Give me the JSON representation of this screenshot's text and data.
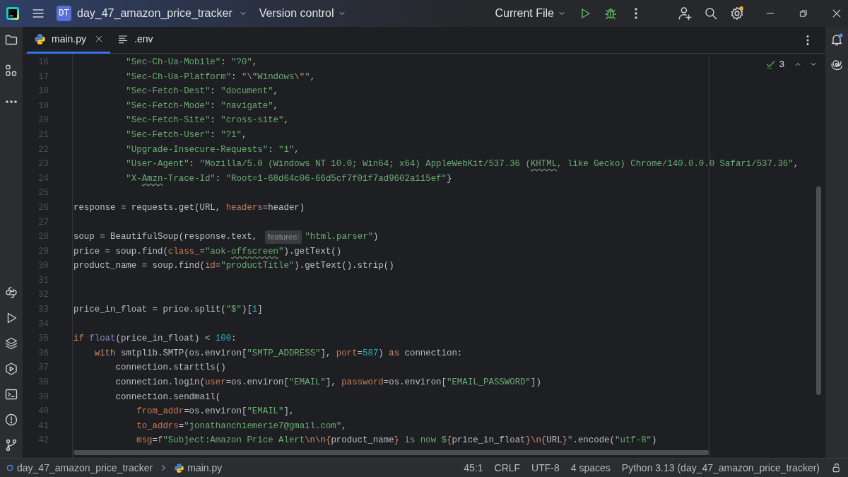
{
  "title_bar": {
    "project_badge": "DT",
    "project": "day_47_amazon_price_tracker",
    "vcs": "Version control",
    "run_config": "Current File"
  },
  "tabs": [
    {
      "label": "main.py",
      "kind": "python",
      "selected": true
    },
    {
      "label": ".env",
      "kind": "text",
      "selected": false
    }
  ],
  "inspection": {
    "count": "3"
  },
  "code_lines": [
    {
      "number": "16",
      "tokens": [
        {
          "text": "          \"Sec-Ch-Ua-Mobile\"",
          "kind": "s"
        },
        {
          "text": ": ",
          "kind": "p"
        },
        {
          "text": "\"?0\"",
          "kind": "s"
        },
        {
          "text": ",",
          "kind": "p"
        }
      ]
    },
    {
      "number": "17",
      "tokens": [
        {
          "text": "          \"Sec-Ch-Ua-Platform\"",
          "kind": "s"
        },
        {
          "text": ": ",
          "kind": "p"
        },
        {
          "text": "\"",
          "kind": "s"
        },
        {
          "text": "\\\"",
          "kind": "e"
        },
        {
          "text": "Windows",
          "kind": "s"
        },
        {
          "text": "\\\"",
          "kind": "e"
        },
        {
          "text": "\"",
          "kind": "s"
        },
        {
          "text": ",",
          "kind": "p"
        }
      ]
    },
    {
      "number": "18",
      "tokens": [
        {
          "text": "          \"Sec-Fetch-Dest\"",
          "kind": "s"
        },
        {
          "text": ": ",
          "kind": "p"
        },
        {
          "text": "\"document\"",
          "kind": "s"
        },
        {
          "text": ",",
          "kind": "p"
        }
      ]
    },
    {
      "number": "19",
      "tokens": [
        {
          "text": "          \"Sec-Fetch-Mode\"",
          "kind": "s"
        },
        {
          "text": ": ",
          "kind": "p"
        },
        {
          "text": "\"navigate\"",
          "kind": "s"
        },
        {
          "text": ",",
          "kind": "p"
        }
      ]
    },
    {
      "number": "20",
      "tokens": [
        {
          "text": "          \"Sec-Fetch-Site\"",
          "kind": "s"
        },
        {
          "text": ": ",
          "kind": "p"
        },
        {
          "text": "\"cross-site\"",
          "kind": "s"
        },
        {
          "text": ",",
          "kind": "p"
        }
      ]
    },
    {
      "number": "21",
      "tokens": [
        {
          "text": "          \"Sec-Fetch-User\"",
          "kind": "s"
        },
        {
          "text": ": ",
          "kind": "p"
        },
        {
          "text": "\"?1\"",
          "kind": "s"
        },
        {
          "text": ",",
          "kind": "p"
        }
      ]
    },
    {
      "number": "22",
      "tokens": [
        {
          "text": "          \"Upgrade-Insecure-Requests\"",
          "kind": "s"
        },
        {
          "text": ": ",
          "kind": "p"
        },
        {
          "text": "\"1\"",
          "kind": "s"
        },
        {
          "text": ",",
          "kind": "p"
        }
      ]
    },
    {
      "number": "23",
      "tokens": [
        {
          "text": "          \"User-Agent\"",
          "kind": "s"
        },
        {
          "text": ": ",
          "kind": "p"
        },
        {
          "text": "\"Mozilla/5.0 (Windows NT 10.0; Win64; x64) AppleWebKit/537.36 (",
          "kind": "s"
        },
        {
          "text": "KHTML",
          "kind": "typo"
        },
        {
          "text": ", like Gecko) Chrome/140.0.0.0 Safari/537.36\"",
          "kind": "s"
        },
        {
          "text": ",",
          "kind": "p"
        }
      ]
    },
    {
      "number": "24",
      "tokens": [
        {
          "text": "          \"X-",
          "kind": "s"
        },
        {
          "text": "Amzn",
          "kind": "typo"
        },
        {
          "text": "-Trace-Id\"",
          "kind": "s"
        },
        {
          "text": ": ",
          "kind": "p"
        },
        {
          "text": "\"Root=1-68d64c06-66d5cf7f01f7ad9602a115ef\"",
          "kind": "s"
        },
        {
          "text": "}",
          "kind": "p"
        }
      ]
    },
    {
      "number": "25"
    },
    {
      "number": "26",
      "tokens": [
        {
          "text": "response = requests.get(URL, ",
          "kind": "p"
        },
        {
          "text": "headers",
          "kind": "a"
        },
        {
          "text": "=header)",
          "kind": "p"
        }
      ]
    },
    {
      "number": "27"
    },
    {
      "number": "28",
      "tokens": [
        {
          "text": "soup = BeautifulSoup(response.text, ",
          "kind": "p"
        },
        {
          "text": "features:",
          "kind": "h"
        },
        {
          "text": "\"html.parser\"",
          "kind": "s"
        },
        {
          "text": ")",
          "kind": "p"
        }
      ]
    },
    {
      "number": "29",
      "tokens": [
        {
          "text": "price = soup.find(",
          "kind": "p"
        },
        {
          "text": "class_",
          "kind": "a"
        },
        {
          "text": "=",
          "kind": "p"
        },
        {
          "text": "\"aok-",
          "kind": "s"
        },
        {
          "text": "offscreen",
          "kind": "typo"
        },
        {
          "text": "\"",
          "kind": "s"
        },
        {
          "text": ").getText()",
          "kind": "p"
        }
      ]
    },
    {
      "number": "30",
      "tokens": [
        {
          "text": "product_name = soup.find(",
          "kind": "p"
        },
        {
          "text": "id",
          "kind": "a"
        },
        {
          "text": "=",
          "kind": "p"
        },
        {
          "text": "\"productTitle\"",
          "kind": "s"
        },
        {
          "text": ").getText().strip()",
          "kind": "p"
        }
      ]
    },
    {
      "number": "31"
    },
    {
      "number": "32"
    },
    {
      "number": "33",
      "tokens": [
        {
          "text": "price_in_float = price.split(",
          "kind": "p"
        },
        {
          "text": "\"$\"",
          "kind": "s"
        },
        {
          "text": ")[",
          "kind": "p"
        },
        {
          "text": "1",
          "kind": "n"
        },
        {
          "text": "]",
          "kind": "p"
        }
      ]
    },
    {
      "number": "34"
    },
    {
      "number": "35",
      "tokens": [
        {
          "text": "if ",
          "kind": "k"
        },
        {
          "text": "float",
          "kind": "b"
        },
        {
          "text": "(price_in_float) < ",
          "kind": "p"
        },
        {
          "text": "100",
          "kind": "n"
        },
        {
          "text": ":",
          "kind": "p"
        }
      ]
    },
    {
      "number": "36",
      "tokens": [
        {
          "text": "    with ",
          "kind": "k"
        },
        {
          "text": "smtplib.SMTP(os.environ[",
          "kind": "p"
        },
        {
          "text": "\"SMTP_ADDRESS\"",
          "kind": "s"
        },
        {
          "text": "], ",
          "kind": "p"
        },
        {
          "text": "port",
          "kind": "a"
        },
        {
          "text": "=",
          "kind": "p"
        },
        {
          "text": "587",
          "kind": "n"
        },
        {
          "text": ") ",
          "kind": "p"
        },
        {
          "text": "as",
          "kind": "k"
        },
        {
          "text": " connection:",
          "kind": "p"
        }
      ]
    },
    {
      "number": "37",
      "tokens": [
        {
          "text": "        connection.starttls()",
          "kind": "p"
        }
      ]
    },
    {
      "number": "38",
      "tokens": [
        {
          "text": "        connection.login(",
          "kind": "p"
        },
        {
          "text": "user",
          "kind": "a"
        },
        {
          "text": "=os.environ[",
          "kind": "p"
        },
        {
          "text": "\"EMAIL\"",
          "kind": "s"
        },
        {
          "text": "], ",
          "kind": "p"
        },
        {
          "text": "password",
          "kind": "a"
        },
        {
          "text": "=os.environ[",
          "kind": "p"
        },
        {
          "text": "\"EMAIL_PASSWORD\"",
          "kind": "s"
        },
        {
          "text": "])",
          "kind": "p"
        }
      ]
    },
    {
      "number": "39",
      "tokens": [
        {
          "text": "        connection.sendmail(",
          "kind": "p"
        }
      ]
    },
    {
      "number": "40",
      "tokens": [
        {
          "text": "            from_addr",
          "kind": "a"
        },
        {
          "text": "=os.environ[",
          "kind": "p"
        },
        {
          "text": "\"EMAIL\"",
          "kind": "s"
        },
        {
          "text": "],",
          "kind": "p"
        }
      ]
    },
    {
      "number": "41",
      "tokens": [
        {
          "text": "            to_addrs",
          "kind": "a"
        },
        {
          "text": "=",
          "kind": "p"
        },
        {
          "text": "\"jonathanchiemerie7@gmail.com\"",
          "kind": "s"
        },
        {
          "text": ",",
          "kind": "p"
        }
      ]
    },
    {
      "number": "42",
      "tokens": [
        {
          "text": "            msg",
          "kind": "a"
        },
        {
          "text": "=",
          "kind": "p"
        },
        {
          "text": "f",
          "kind": "k"
        },
        {
          "text": "\"Subject:Amazon Price Alert",
          "kind": "s"
        },
        {
          "text": "\\n\\n{",
          "kind": "e"
        },
        {
          "text": "product_name",
          "kind": "p"
        },
        {
          "text": "}",
          "kind": "e"
        },
        {
          "text": " is now $",
          "kind": "s"
        },
        {
          "text": "{",
          "kind": "e"
        },
        {
          "text": "price_in_float",
          "kind": "p"
        },
        {
          "text": "}\\n{",
          "kind": "e"
        },
        {
          "text": "URL",
          "kind": "p"
        },
        {
          "text": "}",
          "kind": "e"
        },
        {
          "text": "\"",
          "kind": "s"
        },
        {
          "text": ".encode(",
          "kind": "p"
        },
        {
          "text": "\"utf-8\"",
          "kind": "s"
        },
        {
          "text": ")",
          "kind": "p"
        }
      ]
    }
  ],
  "breadcrumbs": [
    {
      "label": "day_47_amazon_price_tracker",
      "kind": "module"
    },
    {
      "label": "main.py",
      "kind": "python"
    }
  ],
  "status_bar": [
    "45:1",
    "CRLF",
    "UTF-8",
    "4 spaces",
    "Python 3.13 (day_47_amazon_price_tracker)"
  ]
}
